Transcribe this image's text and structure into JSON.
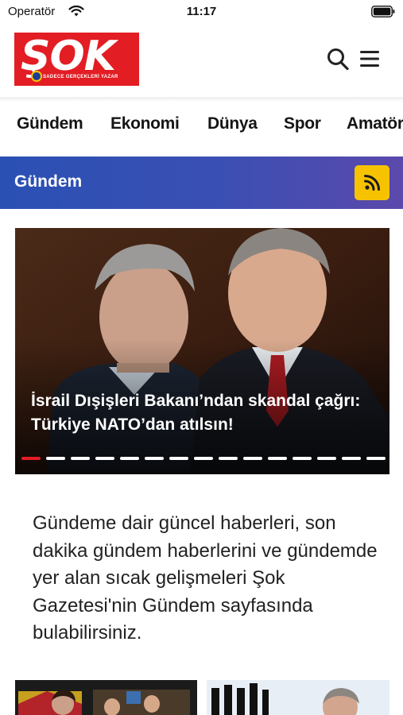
{
  "status_bar": {
    "carrier": "Operatör",
    "time": "11:17"
  },
  "header": {
    "logo_text": "ŞOK",
    "logo_tagline": "SADECE GERÇEKLERİ YAZAR",
    "brand_color": "#e31d24",
    "search_icon": "search-icon",
    "menu_icon": "hamburger-menu-icon"
  },
  "category_nav": {
    "items": [
      "Gündem",
      "Ekonomi",
      "Dünya",
      "Spor",
      "Amatör"
    ]
  },
  "section": {
    "title": "Gündem",
    "rss_icon": "rss-icon",
    "accent_color": "#f7c200"
  },
  "hero": {
    "headline": "İsrail Dışişleri Bakanı’ndan skandal çağrı: Türkiye NATO’dan atılsın!",
    "slide_count": 15,
    "active_slide": 1
  },
  "description": "Gündeme dair güncel haberleri, son dakika gündem haberlerini ve gündemde yer alan sıcak gelişmeleri Şok Gazetesi'nin Gündem sayfasında bulabilirsiniz."
}
